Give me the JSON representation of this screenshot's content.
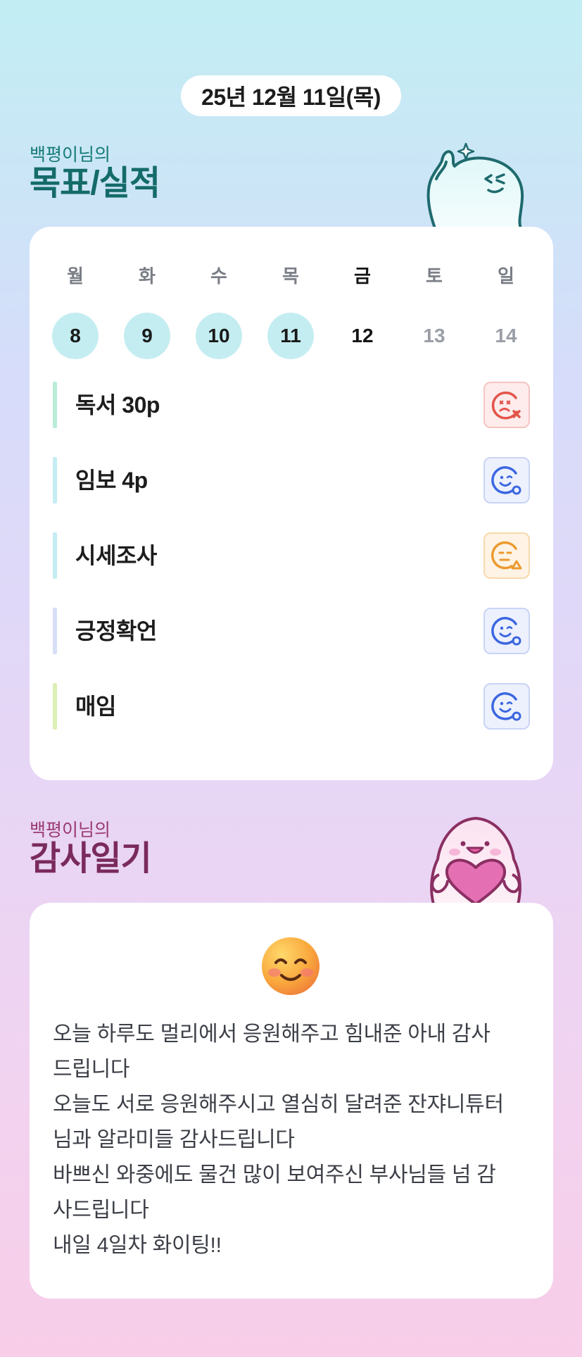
{
  "header": {
    "date": "25년 12월 11일(목)"
  },
  "goal_section": {
    "subtitle": "백평이님의",
    "title": "목표/실적"
  },
  "week": {
    "days": [
      {
        "dow": "월",
        "date": "8",
        "state": "filled"
      },
      {
        "dow": "화",
        "date": "9",
        "state": "filled"
      },
      {
        "dow": "수",
        "date": "10",
        "state": "filled"
      },
      {
        "dow": "목",
        "date": "11",
        "state": "filled"
      },
      {
        "dow": "금",
        "date": "12",
        "state": "today"
      },
      {
        "dow": "토",
        "date": "13",
        "state": "future"
      },
      {
        "dow": "일",
        "date": "14",
        "state": "future"
      }
    ]
  },
  "goals": [
    {
      "label": "독서 30p",
      "status": "fail",
      "status_icon": "sad-face-x-icon",
      "bar_color": "#b9ecd6"
    },
    {
      "label": "임보 4p",
      "status": "good",
      "status_icon": "smile-face-o-icon",
      "bar_color": "#c4ecf3"
    },
    {
      "label": "시세조사",
      "status": "partial",
      "status_icon": "neutral-face-triangle-icon",
      "bar_color": "#c4ecf3"
    },
    {
      "label": "긍정확언",
      "status": "good",
      "status_icon": "smile-face-o-icon",
      "bar_color": "#d7dff8"
    },
    {
      "label": "매임",
      "status": "good",
      "status_icon": "smile-face-o-icon",
      "bar_color": "#dcefb4"
    }
  ],
  "gratitude_section": {
    "subtitle": "백평이님의",
    "title": "감사일기",
    "emoji_icon": "smiling-face-emoji-icon",
    "lines": [
      "오늘 하루도 멀리에서 응원해주고 힘내준 아내 감사",
      "드립니다",
      "오늘도 서로 응원해주시고 열심히 달려준 잔쟈니튜터",
      "님과 알라미들 감사드립니다",
      "바쁘신 와중에도 물건 많이 보여주신 부사님들 넘 감",
      "사드립니다",
      "내일 4일차 화이팅!!"
    ]
  },
  "colors": {
    "goal_title": "#146b6a",
    "gratitude_title": "#7a2a5c",
    "fail": "#e4544b",
    "good": "#3b67e0",
    "partial": "#ec9a2f",
    "day_filled": "#c4edf1"
  }
}
